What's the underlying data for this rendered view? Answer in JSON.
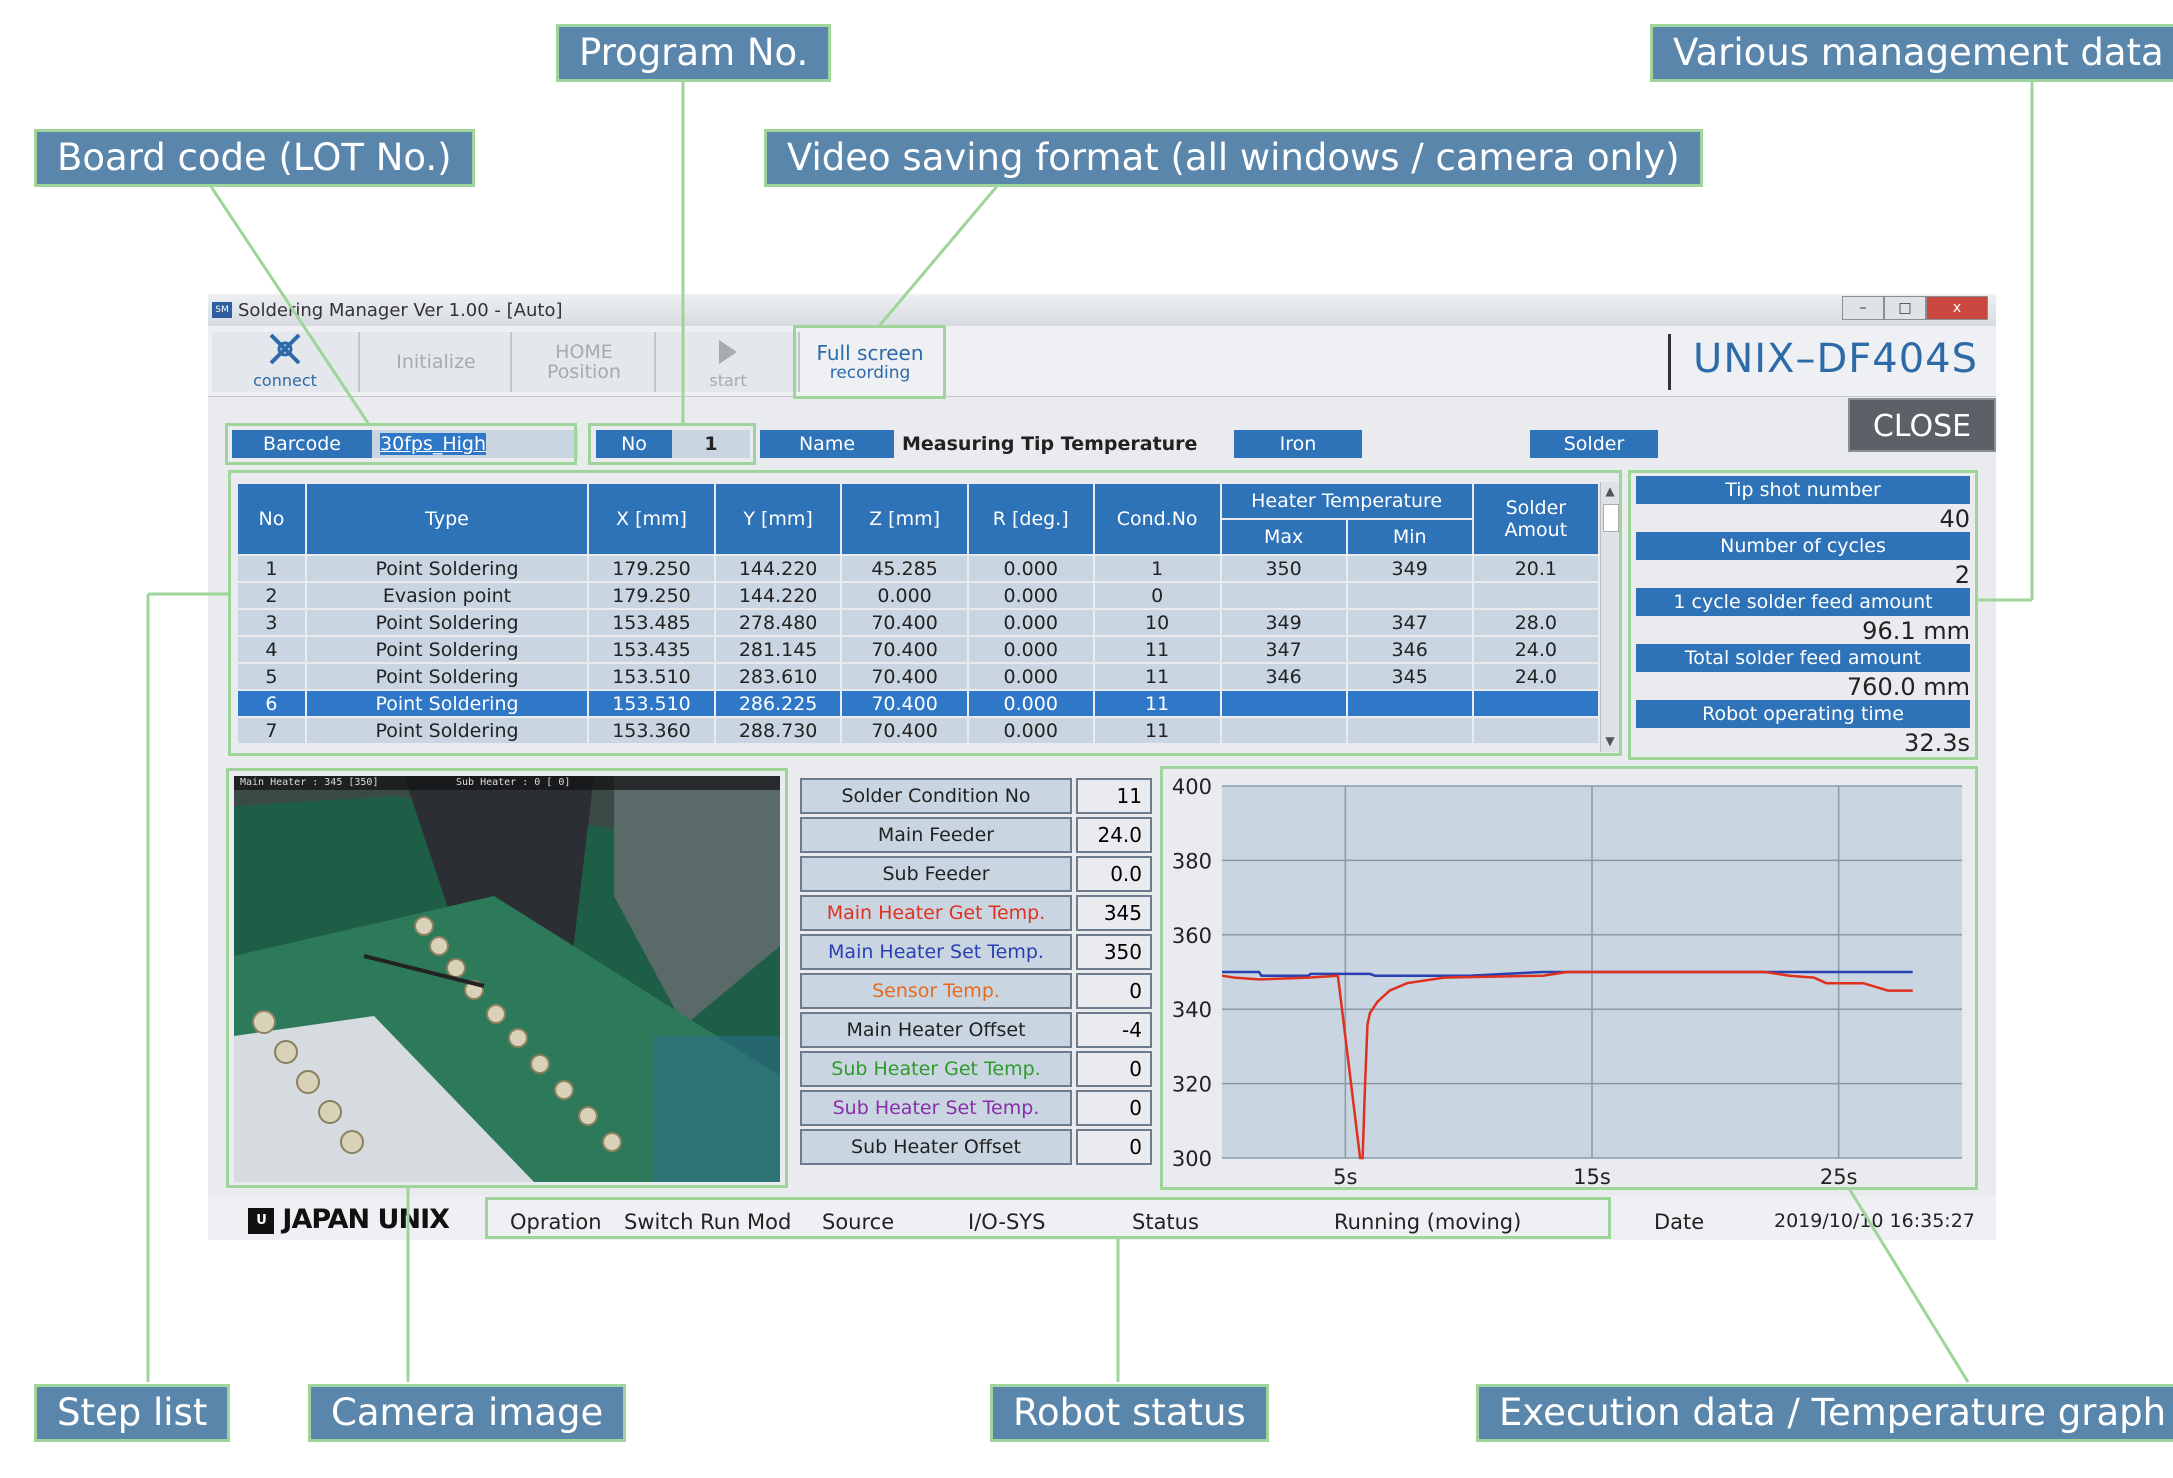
{
  "callouts": {
    "program_no": "Program No.",
    "management": "Various management data",
    "board_code": "Board code (LOT No.)",
    "video_format": "Video saving format (all windows / camera only)",
    "step_list": "Step list",
    "camera_image": "Camera image",
    "robot_status": "Robot status",
    "execution_data": "Execution data / Temperature graph"
  },
  "window": {
    "title": "Soldering Manager Ver 1.00 - [Auto]",
    "app_icon": "SM",
    "controls": {
      "minimize": "–",
      "maximize": "□",
      "close": "x"
    }
  },
  "toolbar": {
    "connect": "connect",
    "initialize": "Initialize",
    "home_line1": "HOME",
    "home_line2": "Position",
    "start": "start",
    "full_screen_line1": "Full screen",
    "full_screen_line2": "recording",
    "model": "UNIX–DF404S"
  },
  "infobar": {
    "barcode_label": "Barcode",
    "barcode_value": "30fps_High",
    "no_label": "No",
    "no_value": "1",
    "name_label": "Name",
    "name_value": "Measuring Tip Temperature",
    "iron_label": "Iron",
    "iron_value": "",
    "solder_label": "Solder",
    "solder_value": "",
    "close_label": "CLOSE"
  },
  "steps": {
    "headers": {
      "no": "No",
      "type": "Type",
      "x": "X [mm]",
      "y": "Y [mm]",
      "z": "Z [mm]",
      "r": "R [deg.]",
      "cond": "Cond.No",
      "heater": "Heater Temperature",
      "max": "Max",
      "min": "Min",
      "solder_line1": "Solder",
      "solder_line2": "Amout"
    },
    "rows": [
      [
        "1",
        "Point Soldering",
        "179.250",
        "144.220",
        "45.285",
        "0.000",
        "1",
        "350",
        "349",
        "20.1"
      ],
      [
        "2",
        "Evasion point",
        "179.250",
        "144.220",
        "0.000",
        "0.000",
        "0",
        "",
        "",
        ""
      ],
      [
        "3",
        "Point Soldering",
        "153.485",
        "278.480",
        "70.400",
        "0.000",
        "10",
        "349",
        "347",
        "28.0"
      ],
      [
        "4",
        "Point Soldering",
        "153.435",
        "281.145",
        "70.400",
        "0.000",
        "11",
        "347",
        "346",
        "24.0"
      ],
      [
        "5",
        "Point Soldering",
        "153.510",
        "283.610",
        "70.400",
        "0.000",
        "11",
        "346",
        "345",
        "24.0"
      ],
      [
        "6",
        "Point Soldering",
        "153.510",
        "286.225",
        "70.400",
        "0.000",
        "11",
        "",
        "",
        ""
      ],
      [
        "7",
        "Point Soldering",
        "153.360",
        "288.730",
        "70.400",
        "0.000",
        "11",
        "",
        "",
        ""
      ]
    ],
    "selected_row": 5
  },
  "management": {
    "tip_shot_label": "Tip shot number",
    "tip_shot_value": "40",
    "cycles_label": "Number of cycles",
    "cycles_value": "2",
    "cycle_feed_label": "1 cycle solder feed amount",
    "cycle_feed_value": "96.1  mm",
    "total_feed_label": "Total solder feed amount",
    "total_feed_value": "760.0  mm",
    "robot_time_label": "Robot operating time",
    "robot_time_value": "32.3s"
  },
  "camera": {
    "overlay_main": "Main Heater : 345 [350]",
    "overlay_sub": "Sub Heater :   0 [  0]"
  },
  "conditions": [
    {
      "label": "Solder Condition No",
      "value": "11",
      "color": "#222222"
    },
    {
      "label": "Main Feeder",
      "value": "24.0",
      "color": "#222222"
    },
    {
      "label": "Sub Feeder",
      "value": "0.0",
      "color": "#222222"
    },
    {
      "label": "Main Heater Get Temp.",
      "value": "345",
      "color": "#e0301e"
    },
    {
      "label": "Main Heater Set Temp.",
      "value": "350",
      "color": "#2a3fb0"
    },
    {
      "label": "Sensor Temp.",
      "value": "0",
      "color": "#e86a1e"
    },
    {
      "label": "Main Heater Offset",
      "value": "-4",
      "color": "#222222"
    },
    {
      "label": "Sub Heater Get Temp.",
      "value": "0",
      "color": "#2e9a2e"
    },
    {
      "label": "Sub Heater Set Temp.",
      "value": "0",
      "color": "#8a2ea8"
    },
    {
      "label": "Sub Heater Offset",
      "value": "0",
      "color": "#222222"
    }
  ],
  "chart_data": {
    "type": "line",
    "ylim": [
      300,
      400
    ],
    "xlim": [
      0,
      30
    ],
    "y_ticks": [
      400,
      380,
      360,
      340,
      320,
      300
    ],
    "x_ticks": [
      {
        "v": 5,
        "label": "5s"
      },
      {
        "v": 15,
        "label": "15s"
      },
      {
        "v": 25,
        "label": "25s"
      }
    ],
    "grid": true,
    "series": [
      {
        "color": "#2a3fb0",
        "x": [
          0,
          1.5,
          1.6,
          3.5,
          3.6,
          6,
          6.2,
          10,
          13,
          14,
          22,
          23,
          28
        ],
        "y": [
          350,
          350,
          349,
          349,
          349.5,
          349.5,
          349,
          349,
          350,
          350,
          350,
          350,
          350
        ]
      },
      {
        "color": "#e0301e",
        "x": [
          0,
          0.5,
          1.5,
          3.5,
          4.7,
          5.6,
          5.7,
          5.8,
          5.9,
          6,
          6.3,
          6.8,
          7.5,
          9,
          13,
          14,
          22,
          23,
          24,
          24.5,
          26,
          27,
          28
        ],
        "y": [
          349,
          348.5,
          348,
          348.5,
          349,
          300,
          300,
          320,
          336,
          339,
          342,
          345,
          347,
          348.5,
          349,
          350,
          350,
          349,
          348.5,
          347,
          347,
          345,
          345
        ]
      }
    ]
  },
  "statusbar": {
    "logo": "JAPAN UNIX",
    "operation_label": "Opration",
    "operation_value": "Switch Run Mode",
    "source_label": "Source",
    "source_value": "I/O-SYS",
    "status_label": "Status",
    "status_value": "Running (moving)",
    "date_label": "Date",
    "date_value": "2019/10/10 16:35:27"
  }
}
